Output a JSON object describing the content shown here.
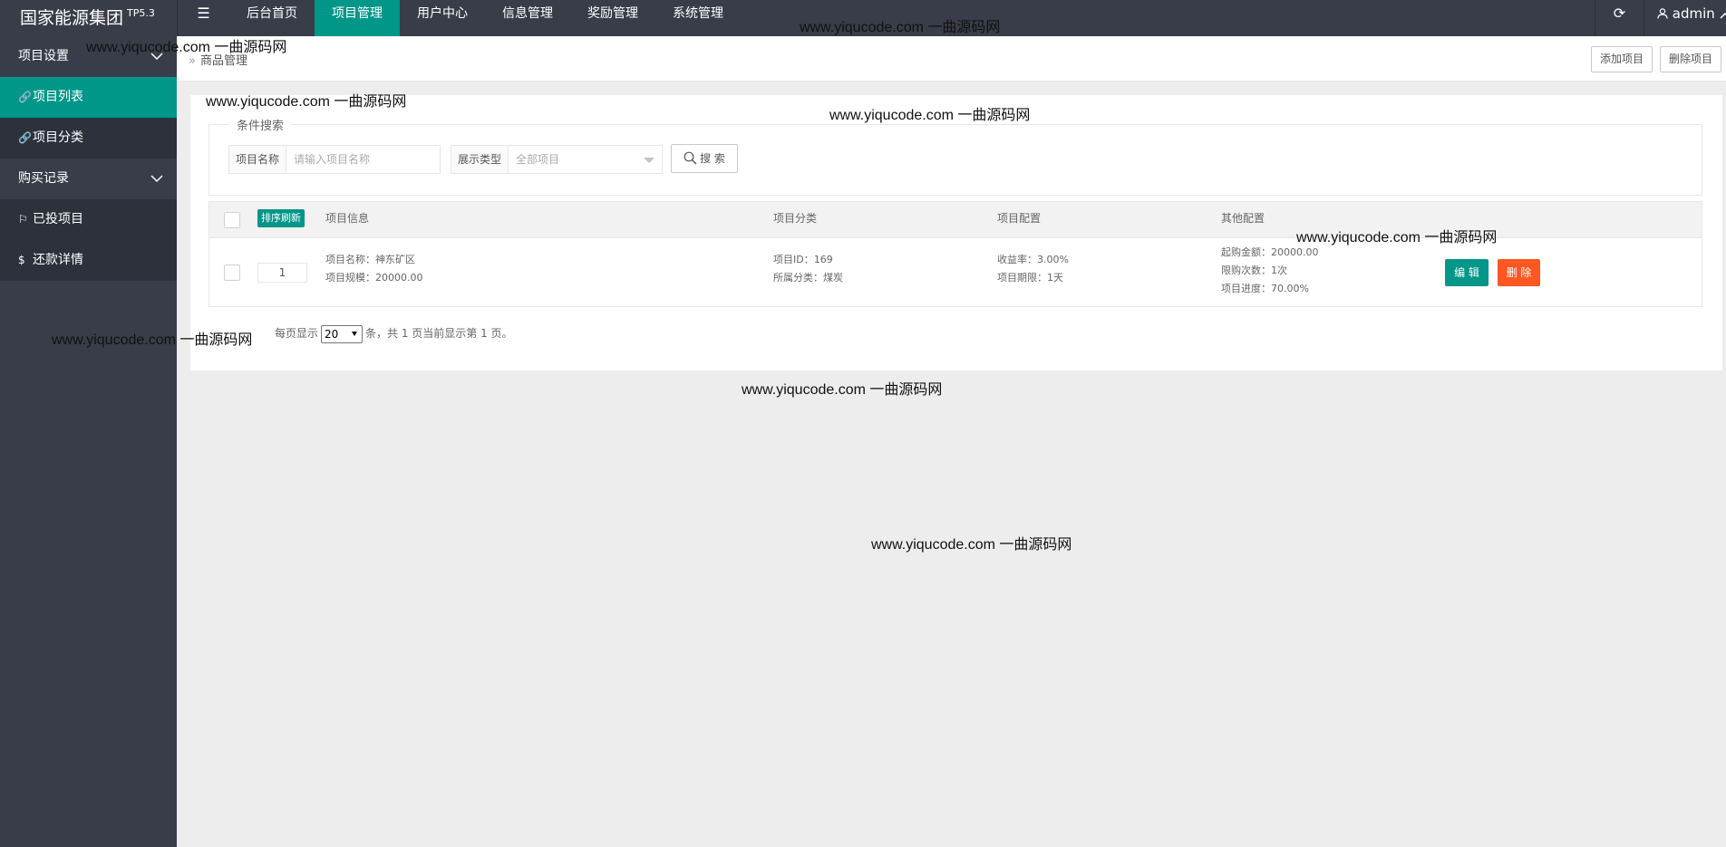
{
  "header": {
    "logo": "国家能源集团",
    "version": "TP5.3",
    "nav": [
      "后台首页",
      "项目管理",
      "用户中心",
      "信息管理",
      "奖励管理",
      "系统管理"
    ],
    "active_nav": "项目管理",
    "user": "admin"
  },
  "sidebar": {
    "group1": "项目设置",
    "item_list": "项目列表",
    "item_category": "项目分类",
    "group2": "购买记录",
    "item_invested": "已投项目",
    "item_repay": "还款详情"
  },
  "breadcrumb": {
    "text": "商品管理",
    "add_btn": "添加项目",
    "del_btn": "删除项目"
  },
  "search": {
    "legend": "条件搜索",
    "name_label": "项目名称",
    "name_placeholder": "请输入项目名称",
    "type_label": "展示类型",
    "type_value": "全部项目",
    "btn": "搜 索"
  },
  "table": {
    "sort_btn": "排序刷新",
    "headers": [
      "项目信息",
      "项目分类",
      "项目配置",
      "其他配置"
    ],
    "rows": [
      {
        "sort": "1",
        "name": "项目名称：神东矿区",
        "scale": "项目规模：20000.00",
        "id": "项目ID：169",
        "category": "所属分类：煤炭",
        "rate": "收益率：3.00%",
        "period": "项目期限：1天",
        "min_amount": "起购金额：20000.00",
        "limit": "限购次数：1次",
        "progress": "项目进度：70.00%",
        "edit": "编 辑",
        "delete": "删 除"
      }
    ]
  },
  "pager": {
    "prefix": "每页显示",
    "size": "20",
    "suffix": "条，共 1 页当前显示第 1 页。"
  },
  "watermark": "www.yiqucode.com  一曲源码网"
}
